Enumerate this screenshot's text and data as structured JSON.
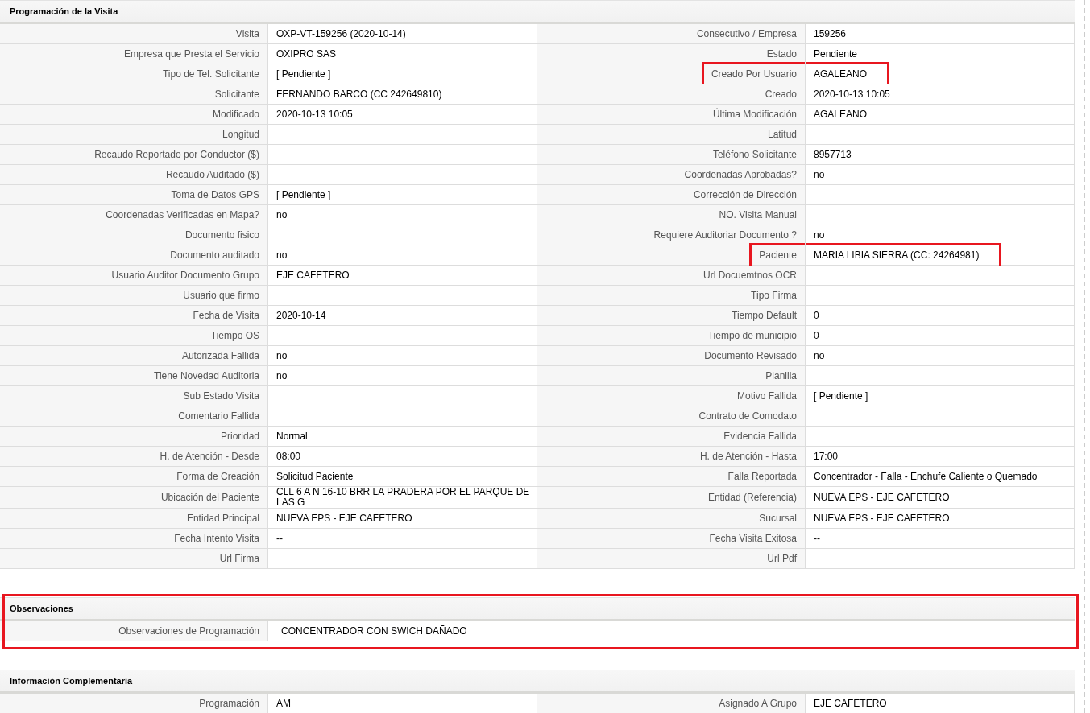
{
  "sections": [
    {
      "title": "Programación de la Visita",
      "highlighted": false,
      "rows": [
        [
          {
            "label": "Visita",
            "value": "OXP-VT-159256 (2020-10-14)",
            "highlighted": false
          },
          {
            "label": "Consecutivo / Empresa",
            "value": "159256",
            "highlighted": false
          }
        ],
        [
          {
            "label": "Empresa que Presta el Servicio",
            "value": "OXIPRO SAS",
            "highlighted": false
          },
          {
            "label": "Estado",
            "value": "Pendiente",
            "highlighted": false
          }
        ],
        [
          {
            "label": "Tipo de Tel. Solicitante",
            "value": "[ Pendiente ]",
            "highlighted": false
          },
          {
            "label": "Creado Por Usuario",
            "value": "AGALEANO",
            "highlighted": true
          }
        ],
        [
          {
            "label": "Solicitante",
            "value": "FERNANDO BARCO (CC 242649810)",
            "highlighted": false
          },
          {
            "label": "Creado",
            "value": "2020-10-13 10:05",
            "highlighted": false
          }
        ],
        [
          {
            "label": "Modificado",
            "value": "2020-10-13 10:05",
            "highlighted": false
          },
          {
            "label": "Última Modificación",
            "value": "AGALEANO",
            "highlighted": false
          }
        ],
        [
          {
            "label": "Longitud",
            "highlighted": false
          },
          {
            "label": "Latitud",
            "highlighted": false
          }
        ],
        [
          {
            "label": "Recaudo Reportado por Conductor ($)",
            "highlighted": false
          },
          {
            "label": "Teléfono Solicitante",
            "value": "8957713",
            "highlighted": false
          }
        ],
        [
          {
            "label": "Recaudo Auditado ($)",
            "highlighted": false
          },
          {
            "label": "Coordenadas Aprobadas?",
            "value": "no",
            "highlighted": false
          }
        ],
        [
          {
            "label": "Toma de Datos GPS",
            "value": "[ Pendiente ]",
            "highlighted": false
          },
          {
            "label": "Corrección de Dirección",
            "highlighted": false
          }
        ],
        [
          {
            "label": "Coordenadas Verificadas en Mapa?",
            "value": "no",
            "highlighted": false
          },
          {
            "label": "NO. Visita Manual",
            "highlighted": false
          }
        ],
        [
          {
            "label": "Documento fisico",
            "highlighted": false
          },
          {
            "label": "Requiere Auditoriar Documento ?",
            "value": "no",
            "highlighted": false
          }
        ],
        [
          {
            "label": "Documento auditado",
            "value": "no",
            "highlighted": false
          },
          {
            "label": "Paciente",
            "value": "MARIA LIBIA SIERRA (CC: 24264981)",
            "highlighted": true
          }
        ],
        [
          {
            "label": "Usuario Auditor Documento Grupo",
            "value": "EJE CAFETERO",
            "highlighted": false
          },
          {
            "label": "Url Docuemtnos OCR",
            "highlighted": false
          }
        ],
        [
          {
            "label": "Usuario que firmo",
            "highlighted": false
          },
          {
            "label": "Tipo Firma",
            "highlighted": false
          }
        ],
        [
          {
            "label": "Fecha de Visita",
            "value": "2020-10-14",
            "highlighted": false
          },
          {
            "label": "Tiempo Default",
            "value": "0",
            "highlighted": false
          }
        ],
        [
          {
            "label": "Tiempo OS",
            "highlighted": false
          },
          {
            "label": "Tiempo de municipio",
            "value": "0",
            "highlighted": false
          }
        ],
        [
          {
            "label": "Autorizada Fallida",
            "value": "no",
            "highlighted": false
          },
          {
            "label": "Documento Revisado",
            "value": "no",
            "highlighted": false
          }
        ],
        [
          {
            "label": "Tiene Novedad Auditoria",
            "value": "no",
            "highlighted": false
          },
          {
            "label": "Planilla",
            "highlighted": false
          }
        ],
        [
          {
            "label": "Sub Estado Visita",
            "highlighted": false
          },
          {
            "label": "Motivo Fallida",
            "value": "[ Pendiente ]",
            "highlighted": false
          }
        ],
        [
          {
            "label": "Comentario Fallida",
            "highlighted": false
          },
          {
            "label": "Contrato de Comodato",
            "highlighted": false
          }
        ],
        [
          {
            "label": "Prioridad",
            "value": "Normal",
            "highlighted": false
          },
          {
            "label": "Evidencia Fallida",
            "highlighted": false
          }
        ],
        [
          {
            "label": "H. de Atención - Desde",
            "value": "08:00",
            "highlighted": false
          },
          {
            "label": "H. de Atención - Hasta",
            "value": "17:00",
            "highlighted": false
          }
        ],
        [
          {
            "label": "Forma de Creación",
            "value": "Solicitud Paciente",
            "highlighted": false
          },
          {
            "label": "Falla Reportada",
            "value": "Concentrador - Falla - Enchufe Caliente o Quemado",
            "highlighted": false
          }
        ],
        [
          {
            "label": "Ubicación del Paciente",
            "value": "CLL 6 A N 16-10 BRR LA PRADERA POR EL PARQUE DE LAS G",
            "highlighted": false
          },
          {
            "label": "Entidad (Referencia)",
            "value": "NUEVA EPS - EJE CAFETERO",
            "highlighted": false
          }
        ],
        [
          {
            "label": "Entidad Principal",
            "value": "NUEVA EPS - EJE CAFETERO",
            "highlighted": false
          },
          {
            "label": "Sucursal",
            "value": "NUEVA EPS - EJE CAFETERO",
            "highlighted": false
          }
        ],
        [
          {
            "label": "Fecha Intento Visita",
            "value": "--",
            "highlighted": false
          },
          {
            "label": "Fecha Visita Exitosa",
            "value": "--",
            "highlighted": false
          }
        ],
        [
          {
            "label": "Url Firma",
            "highlighted": false
          },
          {
            "label": "Url Pdf",
            "highlighted": false
          }
        ]
      ]
    },
    {
      "title": "Observaciones",
      "highlighted": true,
      "rows": [
        [
          {
            "label": "Observaciones de Programación",
            "value": "CONCENTRADOR CON SWICH DAÑADO",
            "highlighted": false
          }
        ]
      ]
    },
    {
      "title": "Información Complementaria",
      "highlighted": false,
      "rows": [
        [
          {
            "label": "Programación",
            "value": "AM",
            "highlighted": false
          },
          {
            "label": "Asignado A Grupo",
            "value": "EJE CAFETERO",
            "highlighted": false
          }
        ]
      ]
    }
  ]
}
